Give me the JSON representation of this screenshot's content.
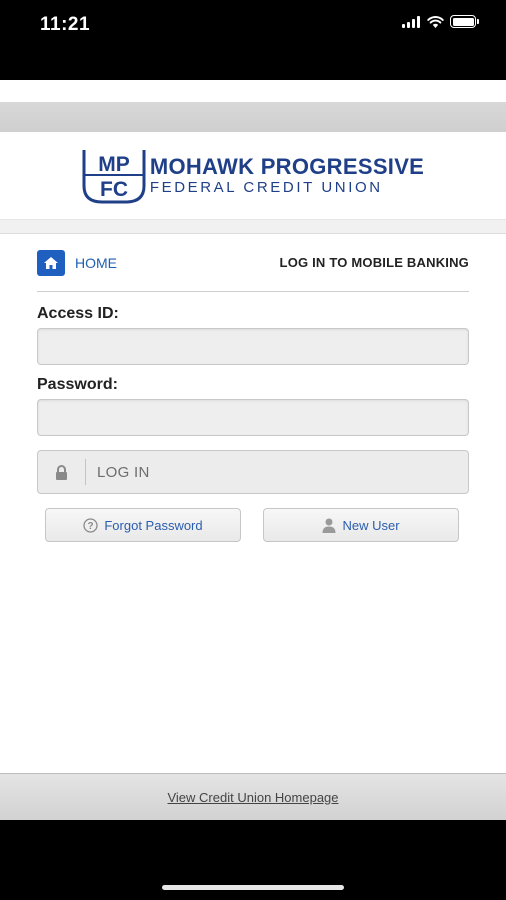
{
  "status": {
    "time": "11:21"
  },
  "logo": {
    "mark_top": "MP",
    "mark_bottom": "FC",
    "line1": "MOHAWK PROGRESSIVE",
    "line2": "FEDERAL CREDIT UNION"
  },
  "nav": {
    "home_label": "HOME",
    "title": "LOG IN TO MOBILE BANKING"
  },
  "form": {
    "access_label": "Access ID:",
    "access_value": "",
    "password_label": "Password:",
    "password_value": "",
    "login_label": "LOG IN"
  },
  "buttons": {
    "forgot": "Forgot Password",
    "new_user": "New User"
  },
  "footer": {
    "link": "View Credit Union Homepage"
  },
  "colors": {
    "brand_blue": "#1f3f88",
    "link_blue": "#1f5fb0"
  }
}
